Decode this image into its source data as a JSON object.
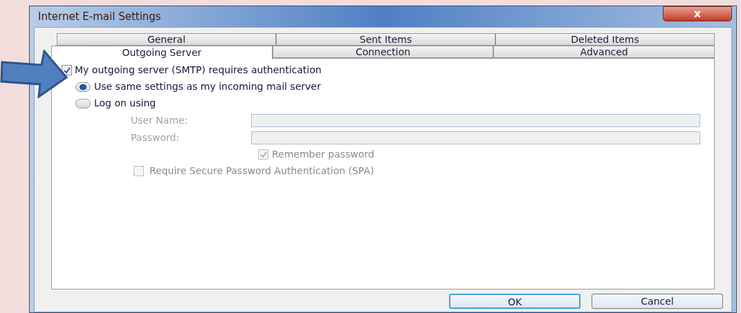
{
  "window": {
    "title": "Internet E-mail Settings",
    "close_label": "x"
  },
  "tab_rows": [
    [
      {
        "label": "General",
        "selected": false
      },
      {
        "label": "Sent Items",
        "selected": false
      },
      {
        "label": "Deleted Items",
        "selected": false
      }
    ],
    [
      {
        "label": "Outgoing Server",
        "selected": true
      },
      {
        "label": "Connection",
        "selected": false
      },
      {
        "label": "Advanced",
        "selected": false
      }
    ]
  ],
  "auth_checkbox": {
    "label": "My outgoing server (SMTP) requires authentication",
    "checked": true
  },
  "auth_options": [
    {
      "label": "Use same settings as my incoming mail server",
      "selected": true
    },
    {
      "label": "Log on using",
      "selected": false
    }
  ],
  "fields": [
    {
      "label": "User Name:",
      "disabled": true
    },
    {
      "label": "Password:",
      "disabled": true
    }
  ],
  "remember_password": {
    "label": "Remember password",
    "checked": true,
    "disabled": true
  },
  "spa_checkbox": {
    "label": "Require Secure Password Authentication (SPA)",
    "checked": false,
    "disabled": true
  },
  "buttons": [
    {
      "label": "OK",
      "default": true
    },
    {
      "label": "Cancel",
      "default": false
    }
  ]
}
